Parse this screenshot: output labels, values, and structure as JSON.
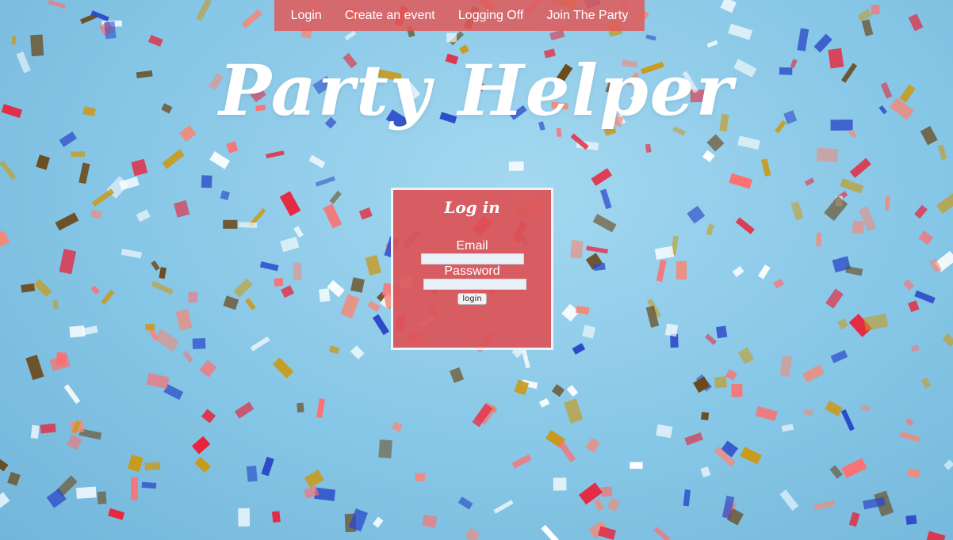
{
  "nav": {
    "items": [
      "Login",
      "Create an event",
      "Logging Off",
      "Join The Party"
    ]
  },
  "header": {
    "title": "Party Helper"
  },
  "login_form": {
    "title": "Log in",
    "email_label": "Email",
    "email_value": "",
    "password_label": "Password",
    "password_value": "",
    "submit_label": "login"
  },
  "colors": {
    "sky": "#8cc8e6",
    "panel": "#db5458",
    "nav": "#de5c5c",
    "confetti": [
      "#e8243c",
      "#ff6f6f",
      "#2a48c8",
      "#f28a7a",
      "#c99a18",
      "#6a4a1c",
      "#ffffff"
    ]
  }
}
